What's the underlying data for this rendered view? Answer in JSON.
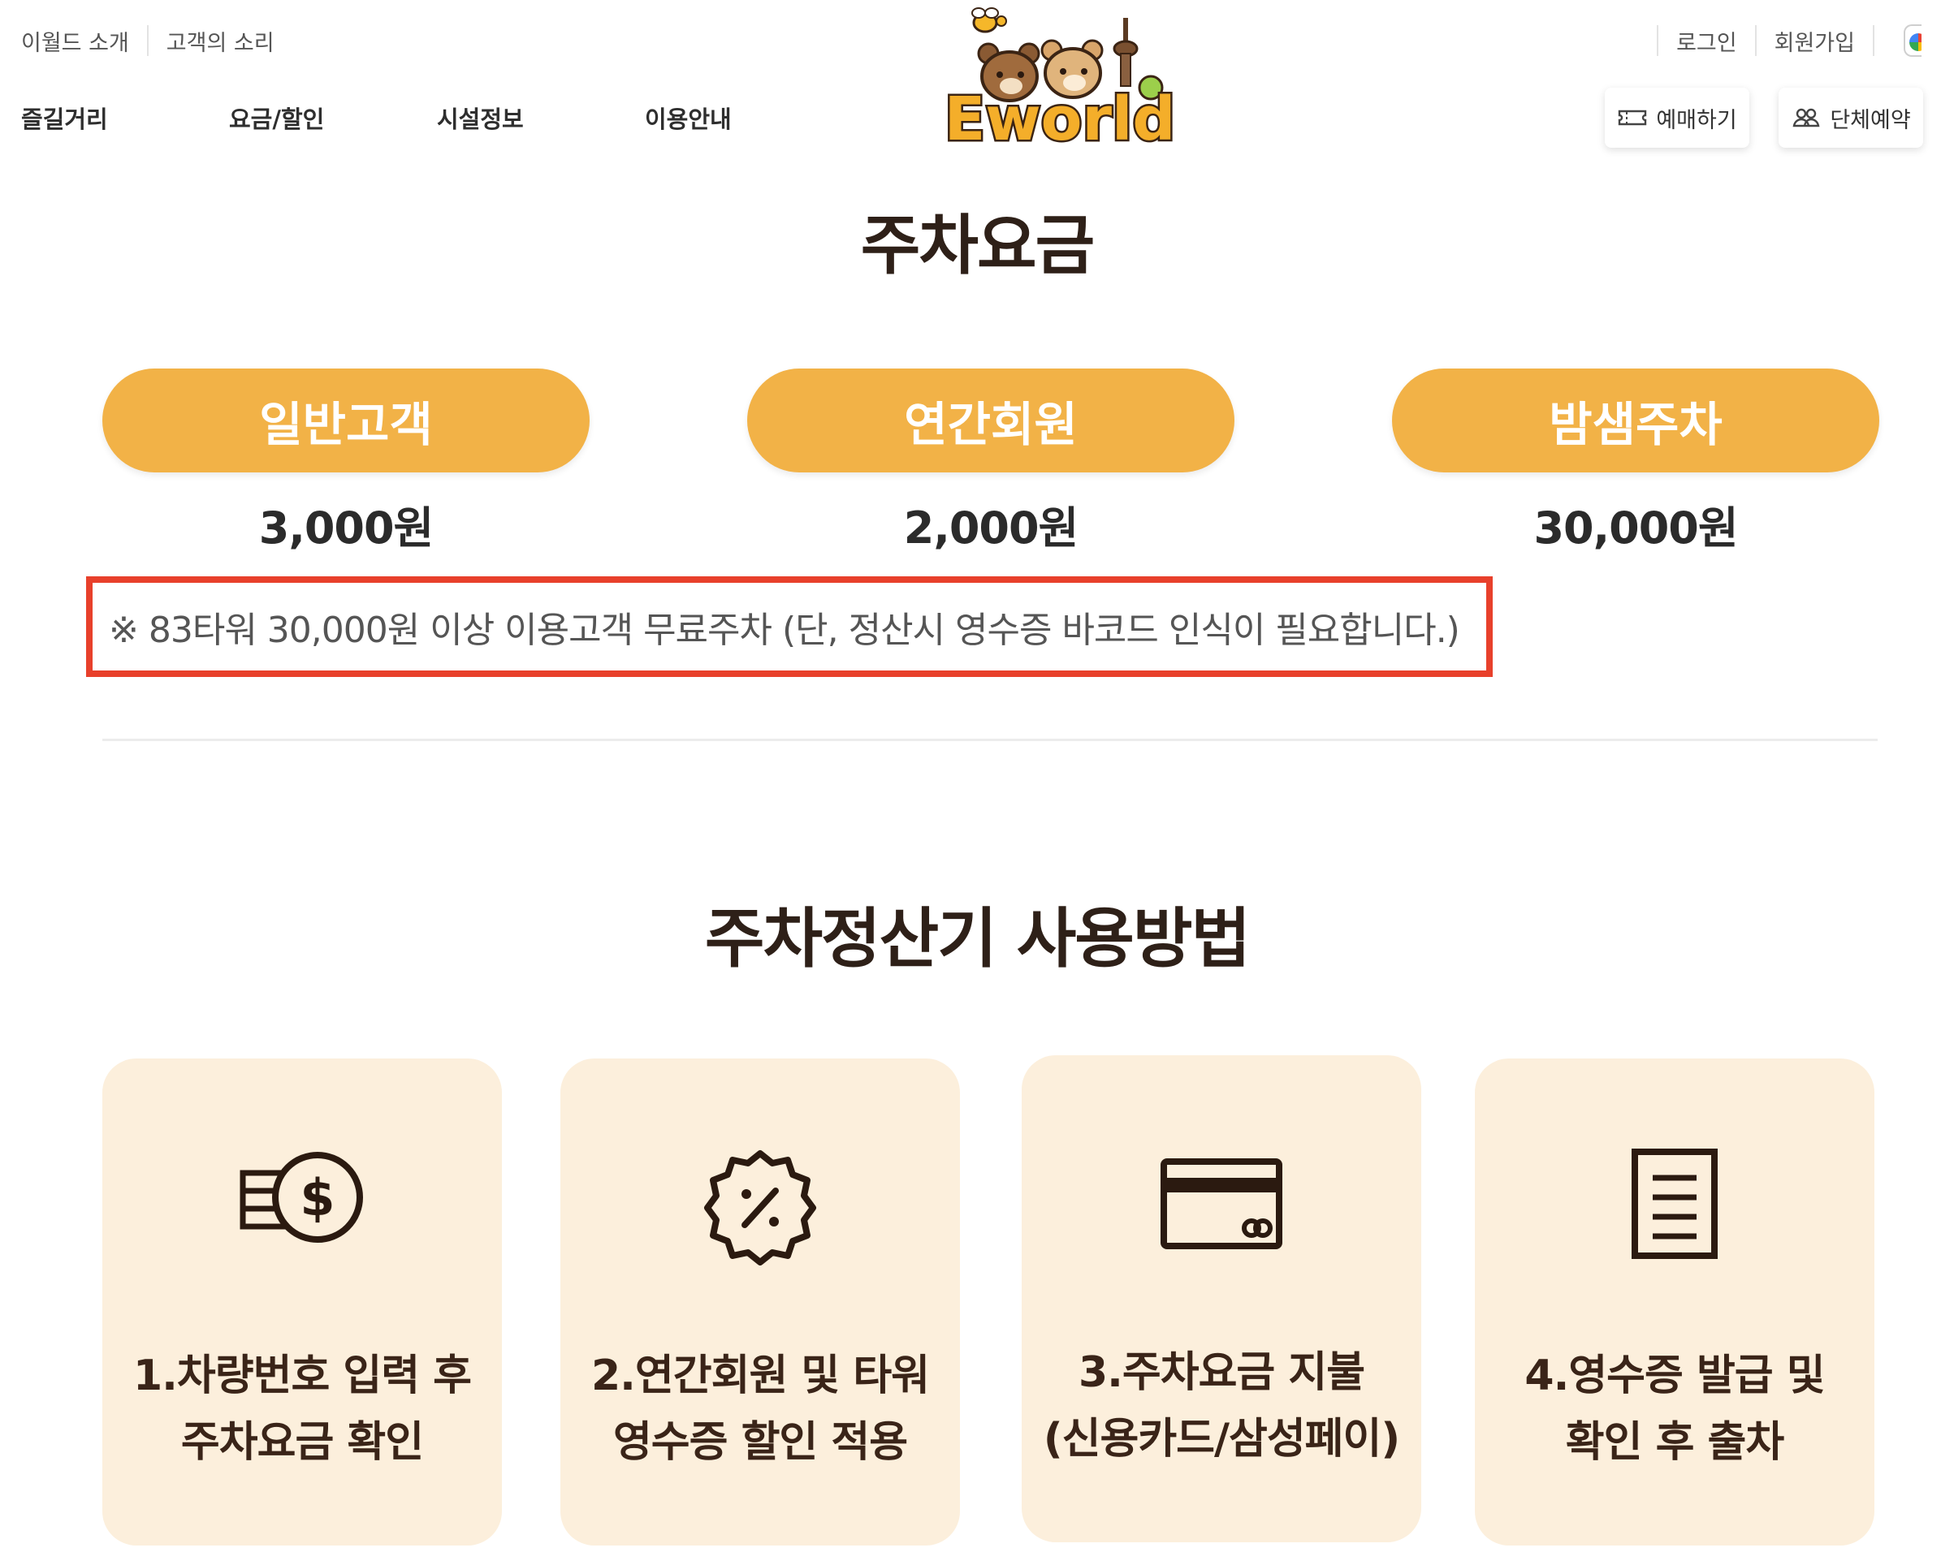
{
  "header": {
    "util_left": [
      "이월드 소개",
      "고객의 소리"
    ],
    "util_right": [
      "로그인",
      "회원가입"
    ],
    "gnb": [
      "즐길거리",
      "요금/할인",
      "시설정보",
      "이용안내"
    ],
    "logo_text": "Eworld",
    "buttons": {
      "booking": "예매하기",
      "group": "단체예약"
    }
  },
  "parking": {
    "title": "주차요금",
    "plans": [
      {
        "name": "일반고객",
        "price": "3,000원"
      },
      {
        "name": "연간회원",
        "price": "2,000원"
      },
      {
        "name": "밤샘주차",
        "price": "30,000원"
      }
    ],
    "notice": "※ 83타워 30,000원 이상 이용고객 무료주차 (단, 정산시 영수증 바코드 인식이 필요합니다.)"
  },
  "howto": {
    "title": "주차정산기 사용방법",
    "steps": [
      {
        "icon": "money-icon",
        "line1": "1.차량번호 입력 후",
        "line2": "주차요금 확인"
      },
      {
        "icon": "discount-badge-icon",
        "line1": "2.연간회원 및 타워",
        "line2": "영수증 할인 적용"
      },
      {
        "icon": "credit-card-icon",
        "line1": "3.주차요금 지불",
        "line2": "(신용카드/삼성페이)"
      },
      {
        "icon": "receipt-icon",
        "line1": "4.영수증 발급 및",
        "line2": "확인 후 출차"
      }
    ]
  },
  "colors": {
    "accent": "#f2b247",
    "card_bg": "#fcefdc",
    "highlight_border": "#e8402b",
    "heading": "#2e2018"
  }
}
